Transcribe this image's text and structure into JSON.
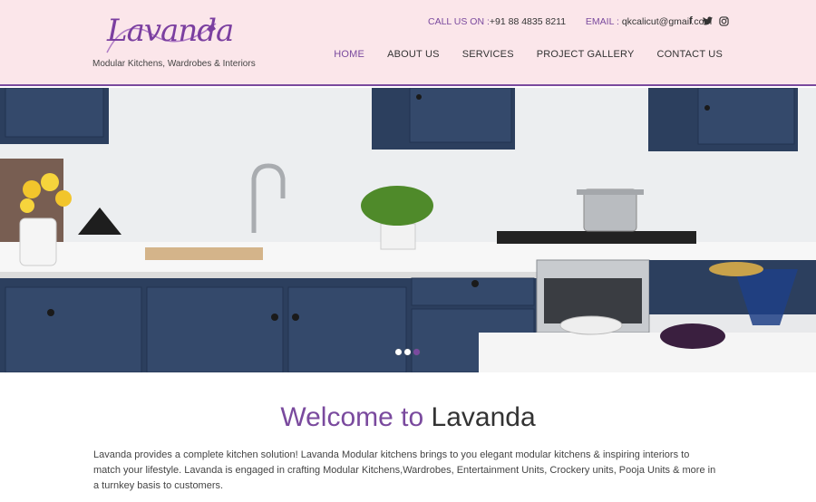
{
  "brand": {
    "name": "Lavanda",
    "tagline": "Modular Kitchens, Wardrobes & Interiors"
  },
  "contact": {
    "call_label": "CALL US ON :",
    "phone": "+91 88 4835 8211",
    "email_label": "EMAIL :",
    "email": "qkcalicut@gmail.com"
  },
  "social": [
    {
      "icon": "facebook-icon",
      "glyph": "f"
    },
    {
      "icon": "twitter-icon",
      "glyph": "t"
    },
    {
      "icon": "instagram-icon",
      "glyph": "◎"
    }
  ],
  "nav": {
    "home": "HOME",
    "about": "ABOUT US",
    "services": "SERVICES",
    "gallery": "PROJECT GALLERY",
    "contact": "CONTACT US",
    "active": "home"
  },
  "slider": {
    "slide_count": 3,
    "active_slide": 3
  },
  "welcome": {
    "prefix": "Welcome to",
    "brand": "Lavanda"
  },
  "intro_text": "Lavanda provides a complete kitchen solution! Lavanda Modular kitchens brings to you elegant modular kitchens & inspiring interiors to match your lifestyle. Lavanda is engaged in crafting Modular Kitchens,Wardrobes, Entertainment Units, Crockery units, Pooja Units & more in a turnkey basis to customers.",
  "colors": {
    "accent": "#7a4a9e",
    "header_bg": "#fbe6ea",
    "cabinet_blue": "#2c3f5e",
    "wall": "#e9eaec"
  }
}
